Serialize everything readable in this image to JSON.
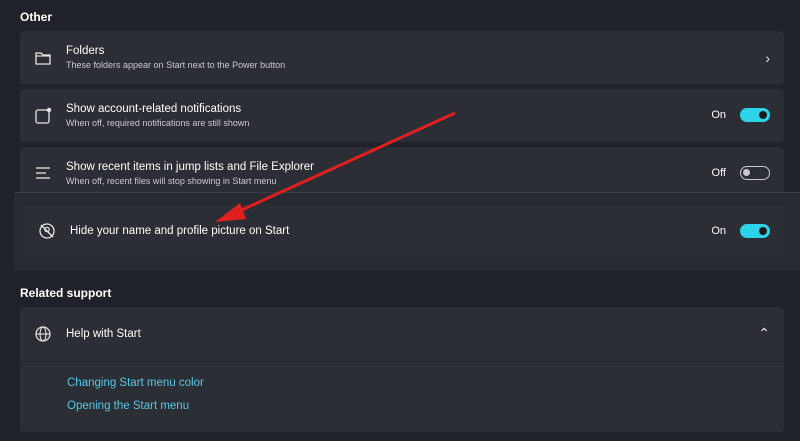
{
  "other": {
    "section_title": "Other",
    "folders": {
      "title": "Folders",
      "description": "These folders appear on Start next to the Power button",
      "icon": "folder-icon"
    },
    "account_notifications": {
      "title": "Show account-related notifications",
      "description": "When off, required notifications are still shown",
      "state": "On",
      "icon": "notification-square-icon"
    },
    "recent_items": {
      "title": "Show recent items in jump lists and File Explorer",
      "description": "When off, recent files will stop showing in Start menu",
      "state": "Off",
      "icon": "list-icon"
    },
    "hide_name": {
      "title": "Hide your name and profile picture on Start",
      "state": "On",
      "icon": "profile-hide-icon"
    }
  },
  "related_support": {
    "section_title": "Related support",
    "help": {
      "title": "Help with Start",
      "icon": "globe-icon",
      "links": [
        "Changing Start menu color",
        "Opening the Start menu"
      ]
    }
  },
  "colors": {
    "accent": "#2bd4e8",
    "link": "#56c8e6",
    "arrow": "#e02020"
  }
}
